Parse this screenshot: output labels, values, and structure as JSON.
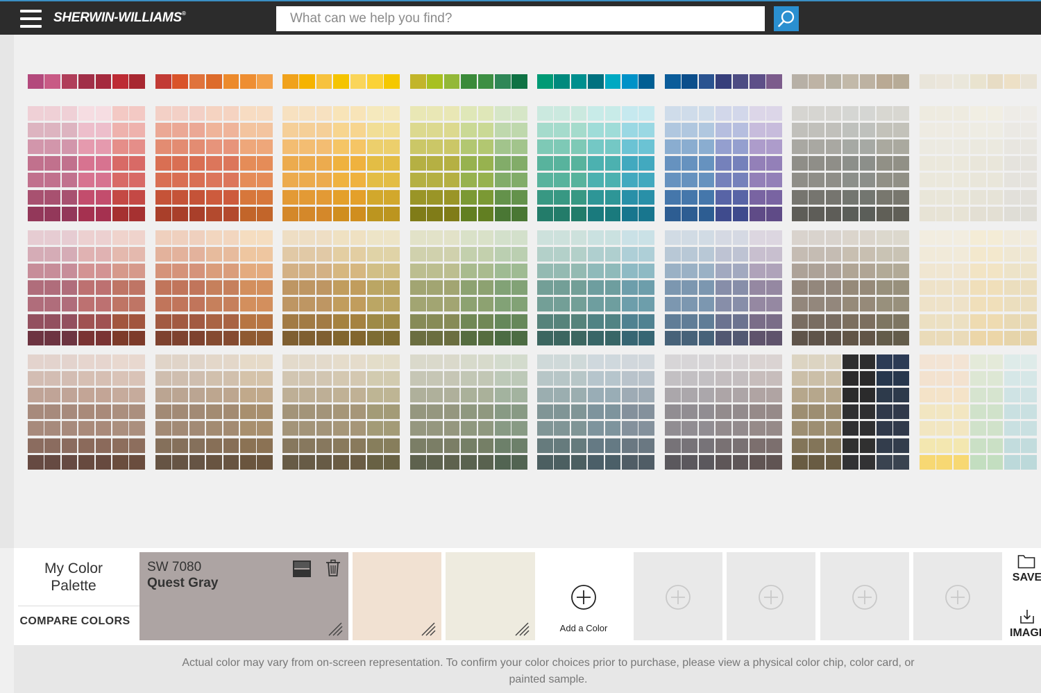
{
  "header": {
    "logo": "SHERWIN-WILLIAMS",
    "logo_mark": "®",
    "search_placeholder": "What can we help you find?"
  },
  "icons": {
    "menu": "hamburger-menu-icon",
    "search": "magnifier-search-icon",
    "compare": "split-view-icon",
    "delete": "trash-icon",
    "add": "plus-circle-icon",
    "save": "folder-icon",
    "image": "download-icon",
    "chip_corner": "diagonal-hatch-icon"
  },
  "palette": {
    "title": "My Color Palette",
    "compare": "COMPARE COLORS",
    "selected": {
      "code": "SW 7080",
      "name": "Quest Gray",
      "color": "#ada4a3"
    },
    "chips": [
      "#f1e1d2",
      "#eeebdf"
    ],
    "add_label": "Add a Color",
    "empty_slots": 4,
    "save_label": "SAVE",
    "image_label": "IMAGE"
  },
  "footer": {
    "disclaimer": "Actual color may vary from on-screen representation. To confirm your color choices prior to purchase, please view a physical color chip, color card, or painted sample."
  },
  "color_wall": {
    "top_strip": [
      [
        "#b3497c",
        "#c85a85",
        "#b03e5a",
        "#a12f48",
        "#a52a3e",
        "#bd2b34",
        "#a82831"
      ],
      [
        "#c23b35",
        "#d9532a",
        "#e0733c",
        "#dd6b2b",
        "#ec8a2c",
        "#ee8e32",
        "#f3a14a"
      ],
      [
        "#f0a21c",
        "#f6b300",
        "#f7c23e",
        "#f5c400",
        "#fad55a",
        "#fbd237",
        "#f5c800"
      ],
      [
        "#c2b52a",
        "#a8c021",
        "#93b838",
        "#3b8a3a",
        "#3d8f43",
        "#2f8757",
        "#0f7244"
      ],
      [
        "#009a75",
        "#00897d",
        "#008f8e",
        "#00717f",
        "#00a9c2",
        "#0092c8",
        "#005e93"
      ],
      [
        "#0b5c9a",
        "#0b4e8b",
        "#2a5390",
        "#373f7b",
        "#4d4c83",
        "#5e4f88",
        "#7c5c8c"
      ],
      [
        "#b7b0a6",
        "#beb3a5",
        "#b8b1a3",
        "#c2b9a9",
        "#bdb2a2",
        "#b9a994",
        "#b7ab97"
      ],
      [
        "#e9e5da",
        "#ebe6db",
        "#eae7db",
        "#e9e3cf",
        "#e7dcc4",
        "#ede0c6",
        "#e9e3d5"
      ]
    ],
    "families": [
      {
        "rows": [
          [
            "#efd0d6",
            "#ddb4c0",
            "#d296ab",
            "#c1718d",
            "#a85170",
            "#93385a"
          ],
          [
            "#f6dde2",
            "#edbecb",
            "#e59aae",
            "#d77390",
            "#c34d6d",
            "#a53150"
          ],
          [
            "#f3c9c4",
            "#eeb2ad",
            "#e58e89",
            "#d86a66",
            "#c44945",
            "#a63131"
          ]
        ],
        "rows2": [
          [
            "#e6ccd2",
            "#d5acb6",
            "#c78d99",
            "#b06d7b",
            "#93505f",
            "#6d3441"
          ],
          [
            "#ecd0d0",
            "#e0b2b2",
            "#d39393",
            "#bd7171",
            "#a05252",
            "#7a3434"
          ],
          [
            "#efd3cc",
            "#e4b9ae",
            "#d6998b",
            "#bf7565",
            "#a2563f",
            "#7d3b2a"
          ]
        ],
        "rows3": [
          [
            "#e3d3cd",
            "#d3bdb3",
            "#c0a497",
            "#a78a7c",
            "#8b6c5f",
            "#664a42"
          ],
          [
            "#e6d5ce",
            "#d6bfb3",
            "#c3a596",
            "#a98a7a",
            "#8b6a5b",
            "#674a3f"
          ],
          [
            "#e8d8cf",
            "#d9c3b7",
            "#c6ab9c",
            "#ab8f7e",
            "#8d6e5d",
            "#6a4d3e"
          ]
        ]
      },
      {
        "rows": [
          [
            "#f3d0c6",
            "#eba895",
            "#e38c72",
            "#d96f53",
            "#c55338",
            "#a93f2a"
          ],
          [
            "#f5d3c1",
            "#efb49a",
            "#e7947b",
            "#dc765b",
            "#cd5b3d",
            "#b34a2e"
          ],
          [
            "#f7dcc2",
            "#f3c49f",
            "#eea77a",
            "#e58c58",
            "#d7773b",
            "#c2652a"
          ]
        ],
        "rows2": [
          [
            "#efd0be",
            "#e3b29c",
            "#d5937a",
            "#c1755b",
            "#a25a42",
            "#7e422f"
          ],
          [
            "#f2d6bf",
            "#e7bb9d",
            "#da9d7b",
            "#c6805c",
            "#a96444",
            "#854b31"
          ],
          [
            "#f5ddc0",
            "#eec6a0",
            "#e4ab7e",
            "#d38f5d",
            "#b77543",
            "#8f5a31"
          ]
        ],
        "rows3": [
          [
            "#e0d4c8",
            "#cfbeaf",
            "#bba592",
            "#a28a75",
            "#85705b",
            "#665444"
          ],
          [
            "#e3d7c9",
            "#d1c0ad",
            "#bda68f",
            "#a38b72",
            "#876f57",
            "#685441"
          ],
          [
            "#e6dac8",
            "#d5c3aa",
            "#c1a98b",
            "#a88f6e",
            "#8b7254",
            "#6a553e"
          ]
        ]
      },
      {
        "rows": [
          [
            "#f7e1c0",
            "#f5cf98",
            "#f3bd72",
            "#ecab4e",
            "#e39a35",
            "#d4882a"
          ],
          [
            "#f8e4b8",
            "#f7d58f",
            "#f5c565",
            "#efb23f",
            "#e4a02a",
            "#d08e1f"
          ],
          [
            "#f5e9bd",
            "#f1de96",
            "#eccf6c",
            "#e3bd45",
            "#d2a82c",
            "#bc951f"
          ]
        ],
        "rows2": [
          [
            "#eedec4",
            "#e1c9a6",
            "#d3b185",
            "#be9663",
            "#a27b45",
            "#7f5f31"
          ],
          [
            "#efe1c2",
            "#e3cea2",
            "#d6b780",
            "#c19d5d",
            "#a58240",
            "#82662e"
          ],
          [
            "#ede4c7",
            "#e0d3a7",
            "#d1bf86",
            "#bba664",
            "#9e8a47",
            "#7d6c33"
          ]
        ],
        "rows3": [
          [
            "#e3dacb",
            "#d2c6b2",
            "#beaf96",
            "#a39479",
            "#87785e",
            "#675b46"
          ],
          [
            "#e5dccb",
            "#d4c8b1",
            "#c0b195",
            "#a69678",
            "#897a5c",
            "#6a5c44"
          ],
          [
            "#e3ddc9",
            "#d2cbb0",
            "#beb594",
            "#a39b77",
            "#877e5c",
            "#686144"
          ]
        ]
      },
      {
        "rows": [
          [
            "#e9e7b5",
            "#dcd98f",
            "#cbc767",
            "#b5b043",
            "#9a9527",
            "#807c18"
          ],
          [
            "#dfe7b8",
            "#cad995",
            "#b2c771",
            "#97b24f",
            "#7b9934",
            "#627f22"
          ],
          [
            "#d6e6c7",
            "#bfd8ad",
            "#a2c48c",
            "#82ac69",
            "#64924b",
            "#4a7734"
          ]
        ],
        "rows2": [
          [
            "#e2e2c8",
            "#d0d1ad",
            "#bcbe90",
            "#a2a572",
            "#878b57",
            "#6b6e40"
          ],
          [
            "#d9e1c8",
            "#c3d0ad",
            "#a9bb8e",
            "#8da271",
            "#718856",
            "#566d40"
          ],
          [
            "#d3e0cb",
            "#bbcfb1",
            "#9fbb93",
            "#82a276",
            "#66885a",
            "#4c6c43"
          ]
        ],
        "rows3": [
          [
            "#dad9cb",
            "#c6c6b5",
            "#afb09b",
            "#95977f",
            "#7b7e66",
            "#5e624e"
          ],
          [
            "#d7dacb",
            "#c2c7b5",
            "#aab19a",
            "#8f987f",
            "#757f66",
            "#59624f"
          ],
          [
            "#d3dbcd",
            "#bdc9b8",
            "#a3b39f",
            "#889a84",
            "#6d806a",
            "#526452"
          ]
        ]
      },
      {
        "rows": [
          [
            "#cbe9df",
            "#a5dbcc",
            "#7ec9b6",
            "#58b39d",
            "#389883",
            "#237c6a"
          ],
          [
            "#c8ebe8",
            "#9fdcd8",
            "#74c8c5",
            "#4cb1b0",
            "#2e9697",
            "#1a7a7d"
          ],
          [
            "#c6e9ef",
            "#9ad8e3",
            "#6bc3d4",
            "#42a9bf",
            "#2990a8",
            "#18768e"
          ]
        ],
        "rows2": [
          [
            "#cde1dc",
            "#b3d0c9",
            "#94bab2",
            "#739f97",
            "#56837b",
            "#3c6660"
          ],
          [
            "#cae1e0",
            "#afcfcf",
            "#8fbaba",
            "#6e9e9f",
            "#518384",
            "#386667"
          ],
          [
            "#cae1e6",
            "#aecfd7",
            "#8ebac4",
            "#6d9eab",
            "#508291",
            "#376673"
          ]
        ],
        "rows3": [
          [
            "#cfd9d9",
            "#b7c6c7",
            "#9baeb0",
            "#809596",
            "#667b7d",
            "#4c5f61"
          ],
          [
            "#cfd8dd",
            "#b6c5cc",
            "#99adb6",
            "#7e949d",
            "#657a84",
            "#4b5f68"
          ],
          [
            "#d1d7dc",
            "#b9c3cb",
            "#9eabb5",
            "#84919c",
            "#6a7882",
            "#505d66"
          ]
        ]
      },
      {
        "rows": [
          [
            "#cfdcea",
            "#b0c7df",
            "#8aadd0",
            "#6692bf",
            "#4577ab",
            "#2d5d92"
          ],
          [
            "#d2d7ea",
            "#b6bedf",
            "#949fcf",
            "#7581bb",
            "#5864a6",
            "#3f4b8d"
          ],
          [
            "#dcd6e8",
            "#c7bcdc",
            "#ad9ccb",
            "#9380b8",
            "#7964a2",
            "#5f4b87"
          ]
        ],
        "rows2": [
          [
            "#d1dbe4",
            "#b8c8d6",
            "#9ab1c5",
            "#7c97b0",
            "#607d97",
            "#476279"
          ],
          [
            "#d5d9e3",
            "#bec3d3",
            "#a2a9c0",
            "#878ea9",
            "#6c7390",
            "#525872"
          ],
          [
            "#dcd6e0",
            "#c8bfcf",
            "#afa3ba",
            "#9588a2",
            "#7a6d88",
            "#5f536c"
          ]
        ],
        "rows3": [
          [
            "#d7d5d7",
            "#c3c0c3",
            "#aba7ab",
            "#918d92",
            "#777378",
            "#5b585d"
          ],
          [
            "#d8d4d5",
            "#c4bec0",
            "#ada5a7",
            "#938b8d",
            "#797173",
            "#5e5658"
          ],
          [
            "#dad3d2",
            "#c7bdbc",
            "#b0a4a3",
            "#968a89",
            "#7c6f6e",
            "#605453"
          ]
        ]
      },
      {
        "rows": [
          [
            "#d6d5d1",
            "#c1c0bb",
            "#a9a8a2",
            "#8f8e88",
            "#76756f",
            "#5e5d58"
          ],
          [
            "#d5d6d3",
            "#bfc1bd",
            "#a6a9a4",
            "#8c8f8a",
            "#737670",
            "#5b5e59"
          ],
          [
            "#d8d7d1",
            "#c3c2ba",
            "#aaa99f",
            "#919086",
            "#78776e",
            "#605f57"
          ]
        ],
        "rows2": [
          [
            "#d9d3cd",
            "#c5bcb3",
            "#ada298",
            "#93877c",
            "#796d62",
            "#5f544a"
          ],
          [
            "#dbd5cc",
            "#c8bfb1",
            "#b0a595",
            "#968a79",
            "#7c6f5f",
            "#615547"
          ],
          [
            "#dcd8cd",
            "#c9c3b4",
            "#b2aa97",
            "#98907c",
            "#7e7662",
            "#635c4a"
          ]
        ],
        "rows3": [
          [
            "#dcd4c2",
            "#cbbfa8",
            "#b6a78c",
            "#9d8e72",
            "#837559",
            "#695c43"
          ],
          [
            "#2d2d2e",
            "#2b2a2b",
            "#2b2b2c",
            "#2f2f31",
            "#303030",
            "#323234"
          ],
          [
            "#2c3b55",
            "#27374d",
            "#2d3a4b",
            "#30394a",
            "#333d4c",
            "#3a4350"
          ]
        ]
      },
      {
        "rows": [
          [
            "#eeebe0",
            "#eeebe2",
            "#eceae1",
            "#ebe8dc",
            "#e9e6d9",
            "#e7e3d5"
          ],
          [
            "#f1eee3",
            "#eeece3",
            "#ebe9df",
            "#e9e6da",
            "#e6e3d7",
            "#e3dfd3"
          ],
          [
            "#eeece7",
            "#ebe9e4",
            "#e8e6e0",
            "#e5e3dd",
            "#e2e0da",
            "#dfddd6"
          ]
        ],
        "rows2": [
          [
            "#f2ede0",
            "#f1ead9",
            "#f0e6d1",
            "#eee2c8",
            "#ece0c2",
            "#eadbb9"
          ],
          [
            "#f4ecd6",
            "#f3e8cd",
            "#f2e4c4",
            "#f0dfba",
            "#eedbb1",
            "#ecd6a8"
          ],
          [
            "#f1ebdc",
            "#efe7d2",
            "#ede3c8",
            "#ebdebe",
            "#e8d9b4",
            "#e6d4aa"
          ]
        ],
        "rows3": [
          [
            "#f3e4d4",
            "#f3e2cf",
            "#f4e3c8",
            "#f2e6c1",
            "#f3e7b0",
            "#f7d873"
          ],
          [
            "#e4ead9",
            "#dde7d4",
            "#d6e4cf",
            "#d0e2ca",
            "#cae0c5",
            "#c3dec0"
          ],
          [
            "#deebe9",
            "#d6e7e7",
            "#cfe3e4",
            "#c9e0e1",
            "#c2dcdd",
            "#bcd9da"
          ]
        ]
      }
    ]
  }
}
